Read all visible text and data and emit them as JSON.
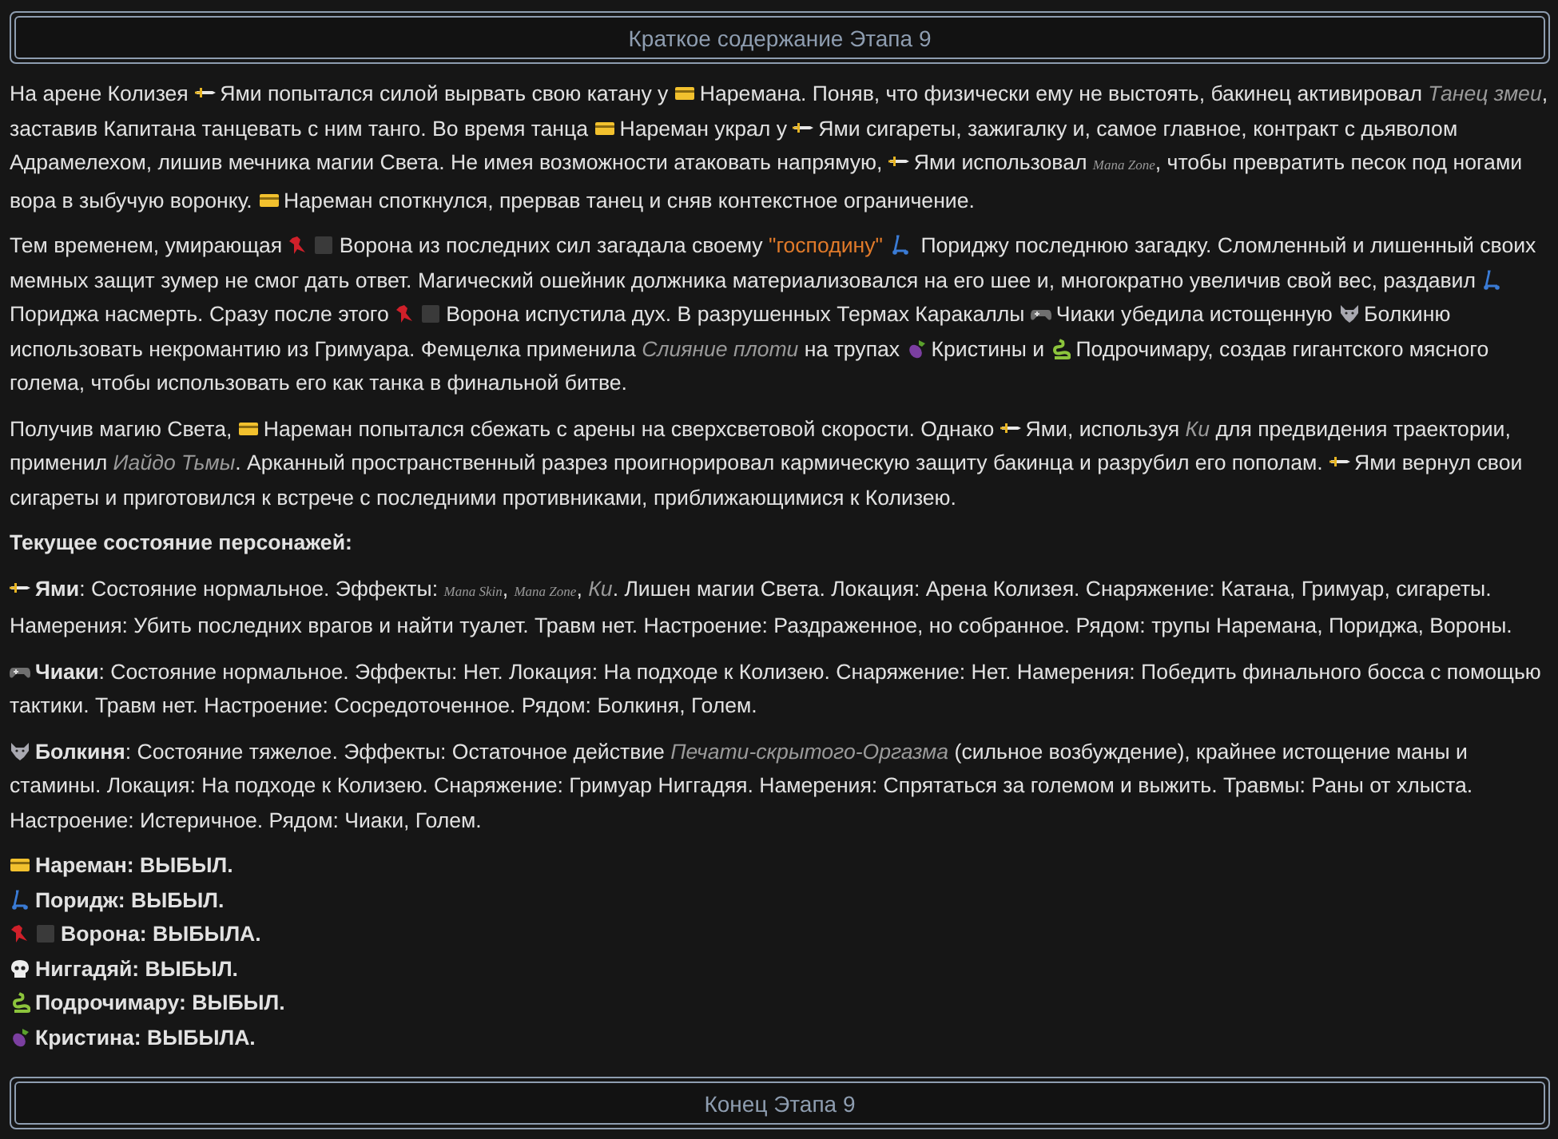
{
  "header": {
    "title": "Краткое содержание Этапа 9"
  },
  "paragraphs": [
    [
      {
        "kind": "text",
        "text": "На арене Колизея "
      },
      {
        "kind": "sword"
      },
      {
        "kind": "text",
        "text": "Ями попытался силой вырвать свою катану у "
      },
      {
        "kind": "card"
      },
      {
        "kind": "text",
        "text": "Наремана. Поняв, что физически ему не выстоять, бакинец активировал "
      },
      {
        "kind": "effect",
        "text": "Танец змеи"
      },
      {
        "kind": "text",
        "text": ", заставив Капитана танцевать с ним танго. Во время танца "
      },
      {
        "kind": "card"
      },
      {
        "kind": "text",
        "text": "Нареман украл у "
      },
      {
        "kind": "sword"
      },
      {
        "kind": "text",
        "text": "Ями сигареты, зажигалку и, самое главное, контракт с дьяволом Адрамелехом, лишив мечника магии Света. Не имея возможности атаковать напрямую, "
      },
      {
        "kind": "sword"
      },
      {
        "kind": "text",
        "text": "Ями использовал "
      },
      {
        "kind": "tiny",
        "text": "Mana Zone"
      },
      {
        "kind": "text",
        "text": ", чтобы превратить песок под ногами вора в зыбучую воронку. "
      },
      {
        "kind": "card"
      },
      {
        "kind": "text",
        "text": "Нареман споткнулся, прервав танец и сняв контекстное ограничение."
      }
    ],
    [
      {
        "kind": "text",
        "text": "Тем временем, умирающая "
      },
      {
        "kind": "bird"
      },
      {
        "kind": "square"
      },
      {
        "kind": "text",
        "text": "Ворона из последних сил загадала своему "
      },
      {
        "kind": "quote",
        "text": "\"господину\""
      },
      {
        "kind": "scooter"
      },
      {
        "kind": "text",
        "text": " Пориджу последнюю загадку. Сломленный и лишенный своих мемных защит зумер не смог дать ответ. Магический ошейник должника материализовался на его шее и, многократно увеличив свой вес, раздавил "
      },
      {
        "kind": "scooter"
      },
      {
        "kind": "text",
        "text": " Пориджа насмерть. Сразу после этого "
      },
      {
        "kind": "bird"
      },
      {
        "kind": "square"
      },
      {
        "kind": "text",
        "text": "Ворона испустила дух. В разрушенных Термах Каракаллы "
      },
      {
        "kind": "gamepad"
      },
      {
        "kind": "text",
        "text": "Чиаки убедила истощенную "
      },
      {
        "kind": "wolf"
      },
      {
        "kind": "text",
        "text": "Болкиню использовать некромантию из Гримуара. Фемцелка применила "
      },
      {
        "kind": "effect",
        "text": "Слияние плоти"
      },
      {
        "kind": "text",
        "text": " на трупах "
      },
      {
        "kind": "eggplant"
      },
      {
        "kind": "text",
        "text": "Кристины и "
      },
      {
        "kind": "snake"
      },
      {
        "kind": "text",
        "text": "Подрочимару, создав гигантского мясного голема, чтобы использовать его как танка в финальной битве."
      }
    ],
    [
      {
        "kind": "text",
        "text": "Получив магию Света, "
      },
      {
        "kind": "card"
      },
      {
        "kind": "text",
        "text": "Нареман попытался сбежать с арены на сверхсветовой скорости. Однако "
      },
      {
        "kind": "sword"
      },
      {
        "kind": "text",
        "text": "Ями, используя "
      },
      {
        "kind": "effect",
        "text": "Ки"
      },
      {
        "kind": "text",
        "text": " для предвидения траектории, применил "
      },
      {
        "kind": "effect",
        "text": "Иайдо Тьмы"
      },
      {
        "kind": "text",
        "text": ". Арканный пространственный разрез проигнорировал кармическую защиту бакинца и разрубил его пополам. "
      },
      {
        "kind": "sword"
      },
      {
        "kind": "text",
        "text": "Ями вернул свои сигареты и приготовился к встрече с последними противниками, приближающимися к Колизею."
      }
    ]
  ],
  "status_heading": "Текущее состояние персонажей:",
  "characters": [
    [
      {
        "kind": "sword"
      },
      {
        "kind": "name",
        "text": "Ями"
      },
      {
        "kind": "text",
        "text": ": Состояние нормальное. Эффекты: "
      },
      {
        "kind": "tiny",
        "text": "Mana Skin"
      },
      {
        "kind": "text",
        "text": ", "
      },
      {
        "kind": "tiny",
        "text": "Mana Zone"
      },
      {
        "kind": "text",
        "text": ", "
      },
      {
        "kind": "effect",
        "text": "Ки"
      },
      {
        "kind": "text",
        "text": ". Лишен магии Света. Локация: Арена Колизея. Снаряжение: Катана, Гримуар, сигареты. Намерения: Убить последних врагов и найти туалет. Травм нет. Настроение: Раздраженное, но собранное. Рядом: трупы Наремана, Пориджа, Вороны."
      }
    ],
    [
      {
        "kind": "gamepad"
      },
      {
        "kind": "name",
        "text": "Чиаки"
      },
      {
        "kind": "text",
        "text": ": Состояние нормальное. Эффекты: Нет. Локация: На подходе к Колизею. Снаряжение: Нет. Намерения: Победить финального босса с помощью тактики. Травм нет. Настроение: Сосредоточенное. Рядом: Болкиня, Голем."
      }
    ],
    [
      {
        "kind": "wolf"
      },
      {
        "kind": "name",
        "text": "Болкиня"
      },
      {
        "kind": "text",
        "text": ": Состояние тяжелое. Эффекты: Остаточное действие "
      },
      {
        "kind": "effect",
        "text": "Печати-скрытого-Оргазма"
      },
      {
        "kind": "text",
        "text": " (сильное возбуждение), крайнее истощение маны и стамины. Локация: На подходе к Колизею. Снаряжение: Гримуар Ниггадяя. Намерения: Спрятаться за големом и выжить. Травмы: Раны от хлыста. Настроение: Истеричное. Рядом: Чиаки, Голем."
      }
    ]
  ],
  "eliminated": [
    [
      {
        "kind": "card"
      },
      {
        "kind": "text",
        "text": "Нареман: ВЫБЫЛ."
      }
    ],
    [
      {
        "kind": "scooter"
      },
      {
        "kind": "text",
        "text": "Поридж: ВЫБЫЛ."
      }
    ],
    [
      {
        "kind": "bird"
      },
      {
        "kind": "square"
      },
      {
        "kind": "text",
        "text": "Ворона: ВЫБЫЛА."
      }
    ],
    [
      {
        "kind": "skull"
      },
      {
        "kind": "text",
        "text": "Ниггадяй: ВЫБЫЛ."
      }
    ],
    [
      {
        "kind": "snake"
      },
      {
        "kind": "text",
        "text": "Подрочимару: ВЫБЫЛ."
      }
    ],
    [
      {
        "kind": "eggplant"
      },
      {
        "kind": "text",
        "text": "Кристина: ВЫБЫЛА."
      }
    ]
  ],
  "footer": {
    "title": "Конец Этапа 9"
  }
}
